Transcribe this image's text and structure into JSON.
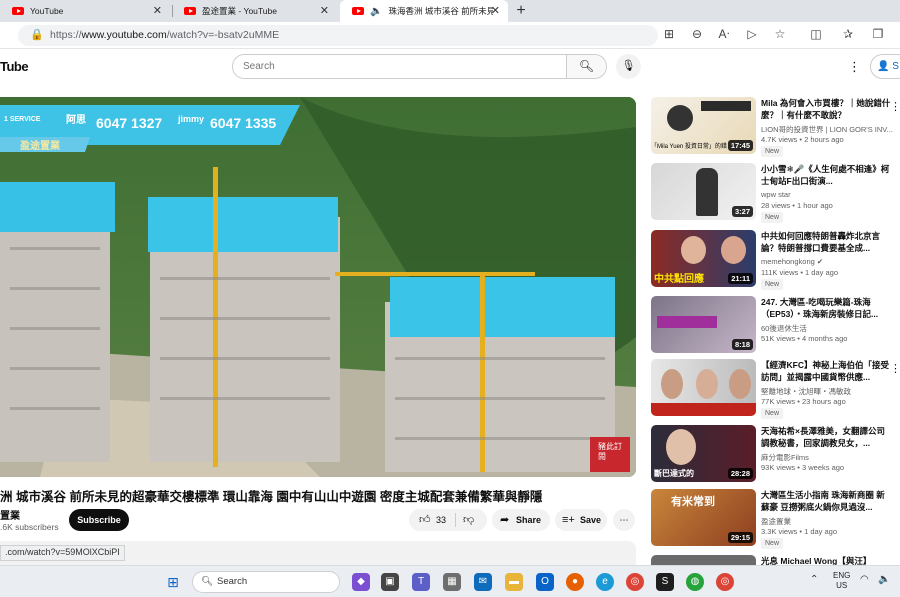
{
  "tabs": [
    {
      "label": "YouTube",
      "active": false
    },
    {
      "label": "盈途置業 - YouTube",
      "active": false
    },
    {
      "label": "珠海香洲 城市溪谷 前所未見",
      "active": true
    }
  ],
  "address": {
    "url_prefix": "https://",
    "url_host": "www.youtube.com",
    "url_path": "/watch?v=-bsatv2uMME"
  },
  "header": {
    "logo": "Tube",
    "search_placeholder": "Search",
    "signin": "S"
  },
  "video": {
    "banner_top": "1 SERVICE",
    "banner_name1": "阿思",
    "banner_phone1": "6047 1327",
    "banner_name2": "jimmy",
    "banner_phone2": "6047 1335",
    "banner_brand": "盈途置業",
    "watermark": "豬此訂閱"
  },
  "main": {
    "title": "洲 城市溪谷 前所未見的超豪華交樓標準 環山靠海 園中有山山中遊園 密度主城配套兼備繁華與靜隱",
    "channel": "盈途置業",
    "subs": ".6K subscribers",
    "subscribe": "Subscribe",
    "likes": "33",
    "share": "Share",
    "save": "Save",
    "status_url": ".com/watch?v=59MOlXCbiPI"
  },
  "recommendations": [
    {
      "title": "Mila 為何會入市買樓？｜她說錯什麼？｜有什麼不敢說？",
      "channel": "LION哥的投資世界 | LION GOR'S INV...",
      "views": "4.7K views",
      "age": "2 hours ago",
      "badge": "New",
      "duration": "17:45",
      "thumb_text": "「Mila Yuen 投資日常」的錯"
    },
    {
      "title": "小小雪❄🎤《人生何處不相逢》柯士甸站F出口街演...",
      "channel": "wpw star",
      "views": "28 views",
      "age": "1 hour ago",
      "badge": "New",
      "duration": "3:27",
      "thumb_text": ""
    },
    {
      "title": "中共如何回應特朗普轟炸北京言論？特朗普撐口費要基全成...",
      "channel": "memehongkong ✔",
      "views": "111K views",
      "age": "1 day ago",
      "badge": "New",
      "duration": "21:11",
      "thumb_text": "中共點回應"
    },
    {
      "title": "247. 大灣區-吃喝玩樂篇-珠海（EP53）・珠海新房裝修日記...",
      "channel": "60後退休生活",
      "views": "51K views",
      "age": "4 months ago",
      "badge": "",
      "duration": "8:18",
      "thumb_text": ""
    },
    {
      "title": "【經濟KFC】神秘上海伯伯「接受訪問」並揭露中國貨幣供應...",
      "channel": "堅離地球・沈旭暉・馮敏政",
      "views": "77K views",
      "age": "23 hours ago",
      "badge": "New",
      "duration": "",
      "thumb_text": ""
    },
    {
      "title": "天海祐希×長澤雅美，女翻譯公司調教秘書，回家調教兒女，...",
      "channel": "麻分電影Films",
      "views": "93K views",
      "age": "3 weeks ago",
      "badge": "",
      "duration": "28:28",
      "thumb_text": "斷巴達式的"
    },
    {
      "title": "大灣區生活小指南 珠海新商圈 新蘇豪 豆撈粥底火鍋你見過沒...",
      "channel": "盈途置業",
      "views": "3.3K views",
      "age": "1 day ago",
      "badge": "New",
      "duration": "29:15",
      "thumb_text": "有米常到"
    },
    {
      "title": "光息 Michael Wong【與汪】",
      "channel": "",
      "views": "",
      "age": "",
      "badge": "",
      "duration": "",
      "thumb_text": ""
    }
  ],
  "taskbar": {
    "search": "Search",
    "lang1": "ENG",
    "lang2": "US"
  }
}
